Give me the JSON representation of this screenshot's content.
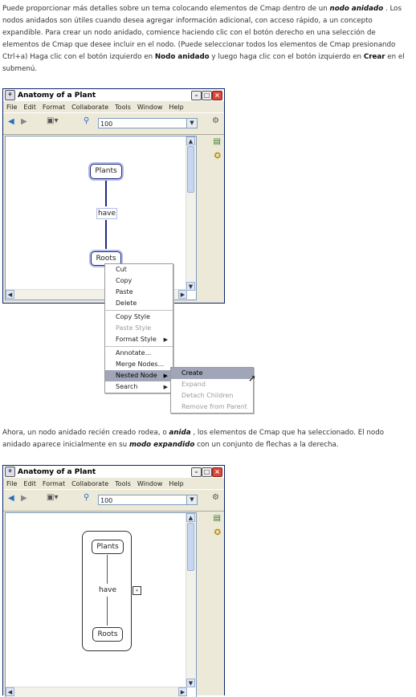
{
  "intro": {
    "p1_a": "Puede proporcionar más detalles sobre un tema colocando elementos de Cmap dentro de un ",
    "p1_b": "nodo anidado",
    "p1_c": " . Los nodos anidados son útiles cuando desea agregar información adicional, con acceso rápido, a un concepto expandible. Para crear un nodo anidado, comience haciendo clic con el botón derecho en una selección de elementos de Cmap que desee incluir en el nodo. (Puede seleccionar todos los elementos de Cmap presionando Ctrl+a) Haga clic con el botón izquierdo en ",
    "p1_d": "Nodo anidado",
    "p1_e": " y luego haga clic con el botón izquierdo en ",
    "p1_f": "Crear",
    "p1_g": " en el submenú."
  },
  "second": {
    "p2_a": "Ahora, un nodo anidado recién creado rodea, o ",
    "p2_b": "anida",
    "p2_c": " , los elementos de Cmap que ha seleccionado. El nodo anidado aparece inicialmente en su ",
    "p2_d": "modo expandido",
    "p2_e": " con un conjunto de flechas a la derecha."
  },
  "window": {
    "title": "Anatomy of a Plant",
    "menus": [
      "File",
      "Edit",
      "Format",
      "Collaborate",
      "Tools",
      "Window",
      "Help"
    ],
    "zoom": "100"
  },
  "map": {
    "node1": "Plants",
    "link": "have",
    "node2": "Roots"
  },
  "context_menu": {
    "items": [
      "Cut",
      "Copy",
      "Paste",
      "Delete",
      "Copy Style",
      "Paste Style",
      "Format Style",
      "Annotate...",
      "Merge Nodes...",
      "Nested Node",
      "Search"
    ]
  },
  "submenu": {
    "items": [
      "Create",
      "Expand",
      "Detach Children",
      "Remove from Parent"
    ]
  },
  "colors": {
    "highlight": "#a0a6b8",
    "selection": "#b4bce8",
    "window_border": "#0a246a"
  }
}
